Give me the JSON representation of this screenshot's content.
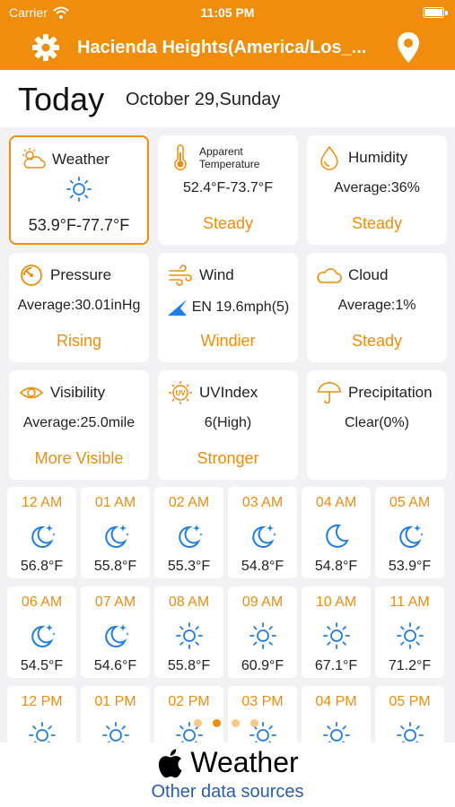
{
  "status_bar": {
    "carrier": "Carrier",
    "time": "11:05 PM"
  },
  "nav": {
    "title": "Hacienda Heights(America/Los_..."
  },
  "date_row": {
    "today": "Today",
    "date": "October 29,Sunday"
  },
  "cards": {
    "weather": {
      "label": "Weather",
      "value": "53.9°F-77.7°F"
    },
    "apparent": {
      "label": "Apparent Temperature",
      "value": "52.4°F-73.7°F",
      "trend": "Steady"
    },
    "humidity": {
      "label": "Humidity",
      "value": "Average:36%",
      "trend": "Steady"
    },
    "pressure": {
      "label": "Pressure",
      "value": "Average:30.01inHg",
      "trend": "Rising"
    },
    "wind": {
      "label": "Wind",
      "value": "EN 19.6mph(5)",
      "trend": "Windier"
    },
    "cloud": {
      "label": "Cloud",
      "value": "Average:1%",
      "trend": "Steady"
    },
    "visibility": {
      "label": "Visibility",
      "value": "Average:25.0mile",
      "trend": "More Visible"
    },
    "uv": {
      "label": "UVIndex",
      "value": "6(High)",
      "trend": "Stronger"
    },
    "precip": {
      "label": "Precipitation",
      "value": "Clear(0%)"
    }
  },
  "hourly": [
    {
      "time": "12 AM",
      "icon": "moon-stars-icon",
      "temp": "56.8°F"
    },
    {
      "time": "01 AM",
      "icon": "moon-stars-icon",
      "temp": "55.8°F"
    },
    {
      "time": "02 AM",
      "icon": "moon-stars-icon",
      "temp": "55.3°F"
    },
    {
      "time": "03 AM",
      "icon": "moon-stars-icon",
      "temp": "54.8°F"
    },
    {
      "time": "04 AM",
      "icon": "moon-icon",
      "temp": "54.8°F"
    },
    {
      "time": "05 AM",
      "icon": "moon-stars-icon",
      "temp": "53.9°F"
    },
    {
      "time": "06 AM",
      "icon": "moon-stars-icon",
      "temp": "54.5°F"
    },
    {
      "time": "07 AM",
      "icon": "moon-stars-icon",
      "temp": "54.6°F"
    },
    {
      "time": "08 AM",
      "icon": "sun-icon",
      "temp": "55.8°F"
    },
    {
      "time": "09 AM",
      "icon": "sun-icon",
      "temp": "60.9°F"
    },
    {
      "time": "10 AM",
      "icon": "sun-icon",
      "temp": "67.1°F"
    },
    {
      "time": "11 AM",
      "icon": "sun-icon",
      "temp": "71.2°F"
    },
    {
      "time": "12 PM",
      "icon": "sun-icon",
      "temp": ""
    },
    {
      "time": "01 PM",
      "icon": "sun-icon",
      "temp": ""
    },
    {
      "time": "02 PM",
      "icon": "sun-icon",
      "temp": ""
    },
    {
      "time": "03 PM",
      "icon": "sun-icon",
      "temp": ""
    },
    {
      "time": "04 PM",
      "icon": "sun-icon",
      "temp": ""
    },
    {
      "time": "05 PM",
      "icon": "sun-icon",
      "temp": ""
    }
  ],
  "footer": {
    "brand": "Weather",
    "other": "Other data sources"
  },
  "colors": {
    "accent": "#f08d0c",
    "icon_blue": "#1e7ee8",
    "link": "#2a5db0"
  }
}
